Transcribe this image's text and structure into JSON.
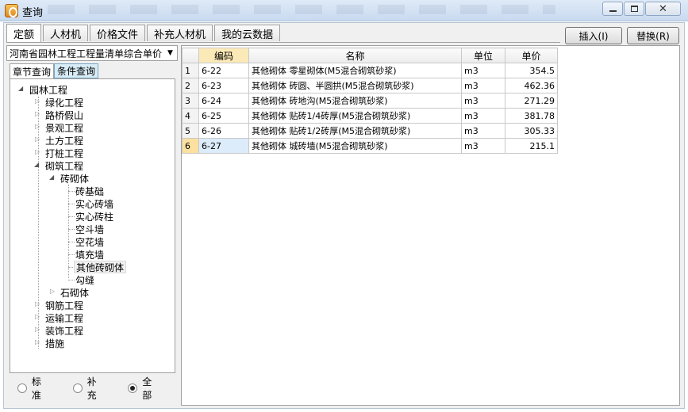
{
  "window": {
    "title": "查询"
  },
  "tabs": [
    "定额",
    "人材机",
    "价格文件",
    "补充人材机",
    "我的云数据"
  ],
  "buttons": {
    "insert": "插入(I)",
    "replace": "替换(R)"
  },
  "combo": {
    "value": "河南省园林工程工程量清单综合单价"
  },
  "subtabs": [
    "章节查询",
    "条件查询"
  ],
  "tree": {
    "root": "园林工程",
    "level1": [
      "绿化工程",
      "路桥假山",
      "景观工程",
      "土方工程",
      "打桩工程",
      "砌筑工程",
      "钢筋工程",
      "运输工程",
      "装饰工程",
      "措施"
    ],
    "brick_group": "砖砌体",
    "brick_items": [
      "砖基础",
      "实心砖墙",
      "实心砖柱",
      "空斗墙",
      "空花墙",
      "填充墙",
      "其他砖砌体",
      "勾缝"
    ],
    "stone_group": "石砌体"
  },
  "radios": [
    "标准",
    "补充",
    "全部"
  ],
  "grid": {
    "headers": [
      "编码",
      "名称",
      "单位",
      "单价"
    ],
    "rows": [
      {
        "n": "1",
        "code": "6-22",
        "name": "其他砌体 零星砌体(M5混合砌筑砂浆)",
        "unit": "m3",
        "price": "354.5"
      },
      {
        "n": "2",
        "code": "6-23",
        "name": "其他砌体 砖圆、半圆拱(M5混合砌筑砂浆)",
        "unit": "m3",
        "price": "462.36"
      },
      {
        "n": "3",
        "code": "6-24",
        "name": "其他砌体 砖地沟(M5混合砌筑砂浆)",
        "unit": "m3",
        "price": "271.29"
      },
      {
        "n": "4",
        "code": "6-25",
        "name": "其他砌体 贴砖1/4砖厚(M5混合砌筑砂浆)",
        "unit": "m3",
        "price": "381.78"
      },
      {
        "n": "5",
        "code": "6-26",
        "name": "其他砌体 贴砖1/2砖厚(M5混合砌筑砂浆)",
        "unit": "m3",
        "price": "305.33"
      },
      {
        "n": "6",
        "code": "6-27",
        "name": "其他砌体 城砖墙(M5混合砌筑砂浆)",
        "unit": "m3",
        "price": "215.1"
      }
    ]
  }
}
